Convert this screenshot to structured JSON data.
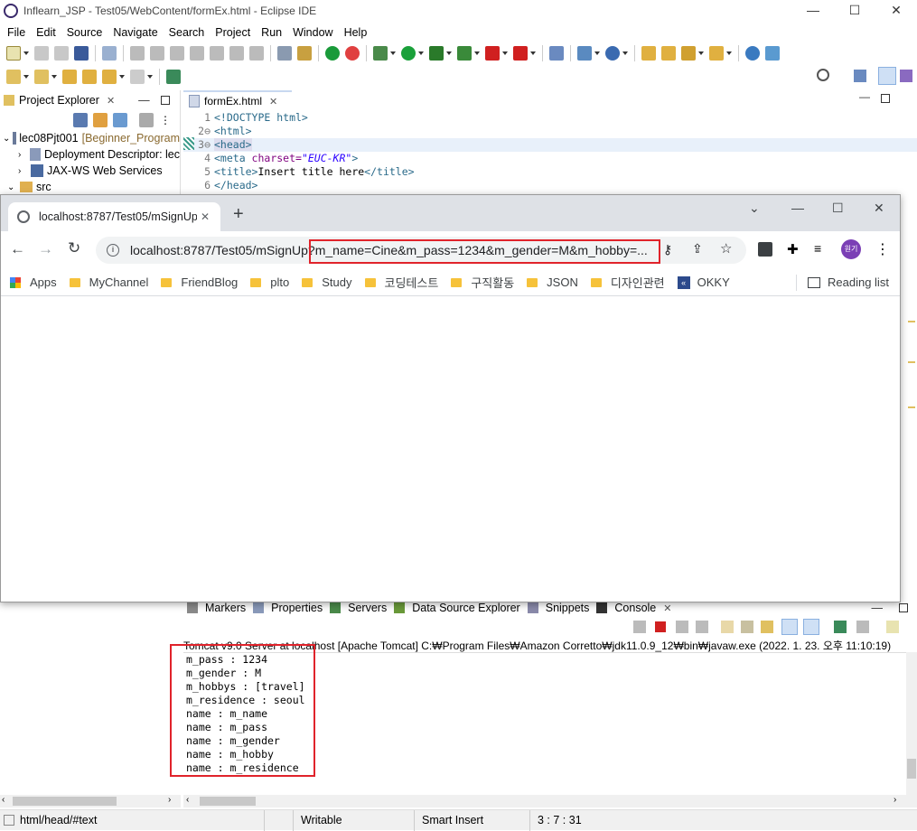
{
  "window": {
    "title": "Inflearn_JSP - Test05/WebContent/formEx.html - Eclipse IDE",
    "minimize": "—",
    "maximize": "☐",
    "close": "✕"
  },
  "menu": [
    "File",
    "Edit",
    "Source",
    "Navigate",
    "Search",
    "Project",
    "Run",
    "Window",
    "Help"
  ],
  "project_explorer": {
    "tab_label": "Project Explorer",
    "tab_close": "✕",
    "items": [
      {
        "label": "lec08Pjt001",
        "decoration": "[Beginner_Program"
      },
      {
        "label": "Deployment Descriptor: lec"
      },
      {
        "label": "JAX-WS Web Services"
      },
      {
        "label": "src"
      }
    ]
  },
  "editor": {
    "tab_label": "formEx.html",
    "tab_close": "✕",
    "lines": [
      {
        "num": "1",
        "text": "<!DOCTYPE html>"
      },
      {
        "num": "2⊖",
        "text": "<html>"
      },
      {
        "num": "3⊖",
        "text": "<head>"
      },
      {
        "num": "4",
        "text": "<meta charset=\"EUC-KR\">"
      },
      {
        "num": "5",
        "text": "<title>Insert title here</title>"
      },
      {
        "num": "6",
        "text": "</head>"
      }
    ]
  },
  "browser": {
    "tab_title": "localhost:8787/Test05/mSignUp?",
    "tab_close": "✕",
    "new_tab": "+",
    "url_host": "localhost:8787/Test05/mSignUp?",
    "url_query": "m_name=Cine&m_pass=1234&m_gender=M&m_hobby=...",
    "profile_initials": "원기",
    "bookmarks": [
      "Apps",
      "MyChannel",
      "FriendBlog",
      "plto",
      "Study",
      "코딩테스트",
      "구직활동",
      "JSON",
      "디자인관련",
      "OKKY"
    ],
    "reading_list": "Reading list",
    "win_min": "—",
    "win_max": "☐",
    "win_close": "✕",
    "tab_menu": "⌄"
  },
  "lower_panel": {
    "tabs": [
      "Markers",
      "Properties",
      "Servers",
      "Data Source Explorer",
      "Snippets",
      "Console"
    ],
    "console_close": "✕",
    "console_header": "Tomcat v9.0 Server at localhost [Apache Tomcat] C:₩Program Files₩Amazon Corretto₩jdk11.0.9_12₩bin₩javaw.exe  (2022. 1. 23. 오후 11:10:19)",
    "console_lines": [
      "m_pass : 1234",
      "m_gender : M",
      "m_hobbys : [travel]",
      "m_residence : seoul",
      "name : m_name",
      "name : m_pass",
      "name : m_gender",
      "name : m_hobby",
      "name : m_residence"
    ]
  },
  "status": {
    "path": "html/head/#text",
    "writable": "Writable",
    "insert_mode": "Smart Insert",
    "position": "3 : 7 : 31"
  },
  "colors": {
    "highlight_red": "#e0232b",
    "chrome_tabstrip": "#dee1e6",
    "profile_purple": "#7b3fb5"
  }
}
